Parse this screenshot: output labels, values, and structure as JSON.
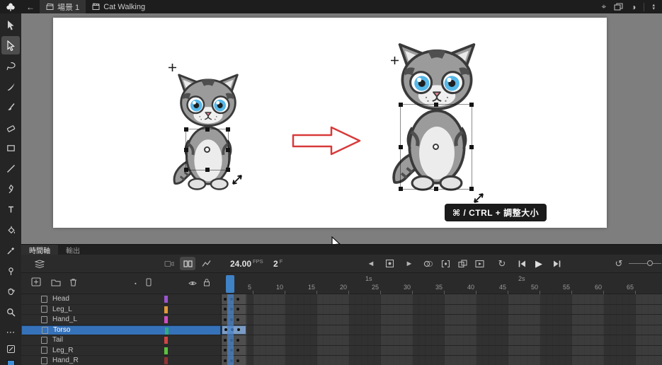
{
  "topbar": {
    "scene_label": "場景 1",
    "document_label": "Cat Walking"
  },
  "icons": {
    "back": "←",
    "target": "⌖",
    "contrast": "◑",
    "step_up": "▴",
    "step_down": "▾",
    "more_dots": "⋯",
    "loop": "↻",
    "play": "▶",
    "prev_keyframe": "◄",
    "next_keyframe": "►",
    "undo": "↺",
    "dot": "•"
  },
  "tool_names": [
    "selection",
    "subselection",
    "lasso",
    "fluid-brush",
    "classic-brush",
    "eraser",
    "rectangle",
    "line",
    "pen",
    "text",
    "paint-bucket",
    "eyedropper",
    "asset-warp",
    "hand",
    "zoom",
    "more-tools"
  ],
  "stage": {
    "resize_tooltip": "⌘ / CTRL + 調整大小"
  },
  "colors": {
    "workspace_gray": "#7e7e7e",
    "stage_white": "#ffffff",
    "arrow_red": "#d93a3a",
    "selection_blue": "#3672b9",
    "playhead_blue": "#3f82c6"
  },
  "timeline": {
    "tabs": [
      {
        "label": "時間軸",
        "active": true
      },
      {
        "label": "輸出",
        "active": false
      }
    ],
    "fps_value": "24.00",
    "fps_unit": "FPS",
    "frame_value": "2",
    "frame_unit": "F",
    "playhead_frame": 2,
    "seconds_labels": [
      {
        "text": "1s",
        "frame": 24
      },
      {
        "text": "2s",
        "frame": 48
      }
    ],
    "ruler_numbers": [
      5,
      10,
      15,
      20,
      25,
      30,
      35,
      40,
      45,
      50,
      55,
      60,
      65
    ],
    "keyframe_dots": [
      1,
      2,
      3
    ],
    "layers": [
      {
        "name": "Head",
        "color": "#9c55cf",
        "selected": false
      },
      {
        "name": "Leg_L",
        "color": "#e09a3a",
        "selected": false
      },
      {
        "name": "Hand_L",
        "color": "#cf4fc0",
        "selected": false
      },
      {
        "name": "Torso",
        "color": "#2fae7e",
        "selected": true
      },
      {
        "name": "Tail",
        "color": "#d24444",
        "selected": false
      },
      {
        "name": "Leg_R",
        "color": "#5cc23e",
        "selected": false
      },
      {
        "name": "Hand_R",
        "color": "#8f3434",
        "selected": false
      }
    ]
  }
}
